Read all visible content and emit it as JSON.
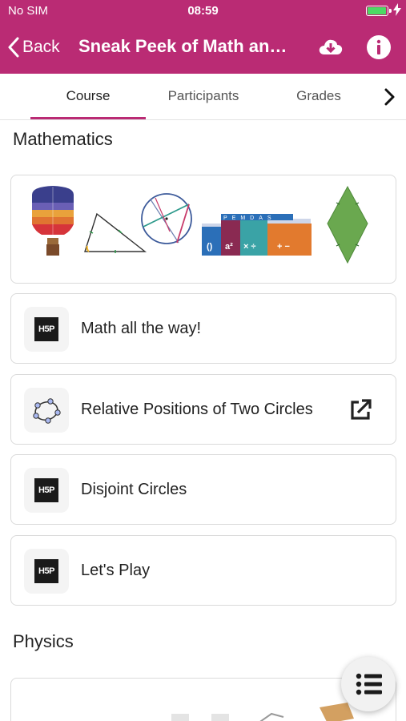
{
  "status_bar": {
    "carrier": "No SIM",
    "time": "08:59",
    "battery_level": 1.0
  },
  "header": {
    "back_label": "Back",
    "title": "Sneak Peek of Math and Physics",
    "download_icon": "cloud-download-icon",
    "info_icon": "info-icon"
  },
  "tabs": {
    "items": [
      {
        "label": "Course"
      },
      {
        "label": "Participants"
      },
      {
        "label": "Grades"
      }
    ],
    "active": "Course",
    "next_icon": "chevron-right-icon"
  },
  "sections": [
    {
      "title": "Mathematics",
      "banner_images": [
        "hot-air-balloon-icon",
        "triangle-icon",
        "circle-chords-icon",
        "pemdas-icon",
        "rhombus-icon"
      ],
      "pemdas": {
        "letters": [
          "P",
          "E",
          "M",
          "D",
          "A",
          "S"
        ],
        "symbols": [
          "()",
          "a²",
          "× ÷",
          "+ −"
        ]
      },
      "items": [
        {
          "label": "Math all the way!",
          "icon": "h5p-icon",
          "icon_text": "H5P"
        },
        {
          "label": "Relative Positions of Two Circles",
          "icon": "geogebra-icon",
          "action_icon": "external-link-icon"
        },
        {
          "label": "Disjoint Circles",
          "icon": "h5p-icon",
          "icon_text": "H5P"
        },
        {
          "label": "Let's Play",
          "icon": "h5p-icon",
          "icon_text": "H5P"
        }
      ]
    },
    {
      "title": "Physics"
    }
  ],
  "fab": {
    "icon": "course-index-icon"
  },
  "colors": {
    "brand": "#ba2b74",
    "battery": "#4cd964"
  }
}
